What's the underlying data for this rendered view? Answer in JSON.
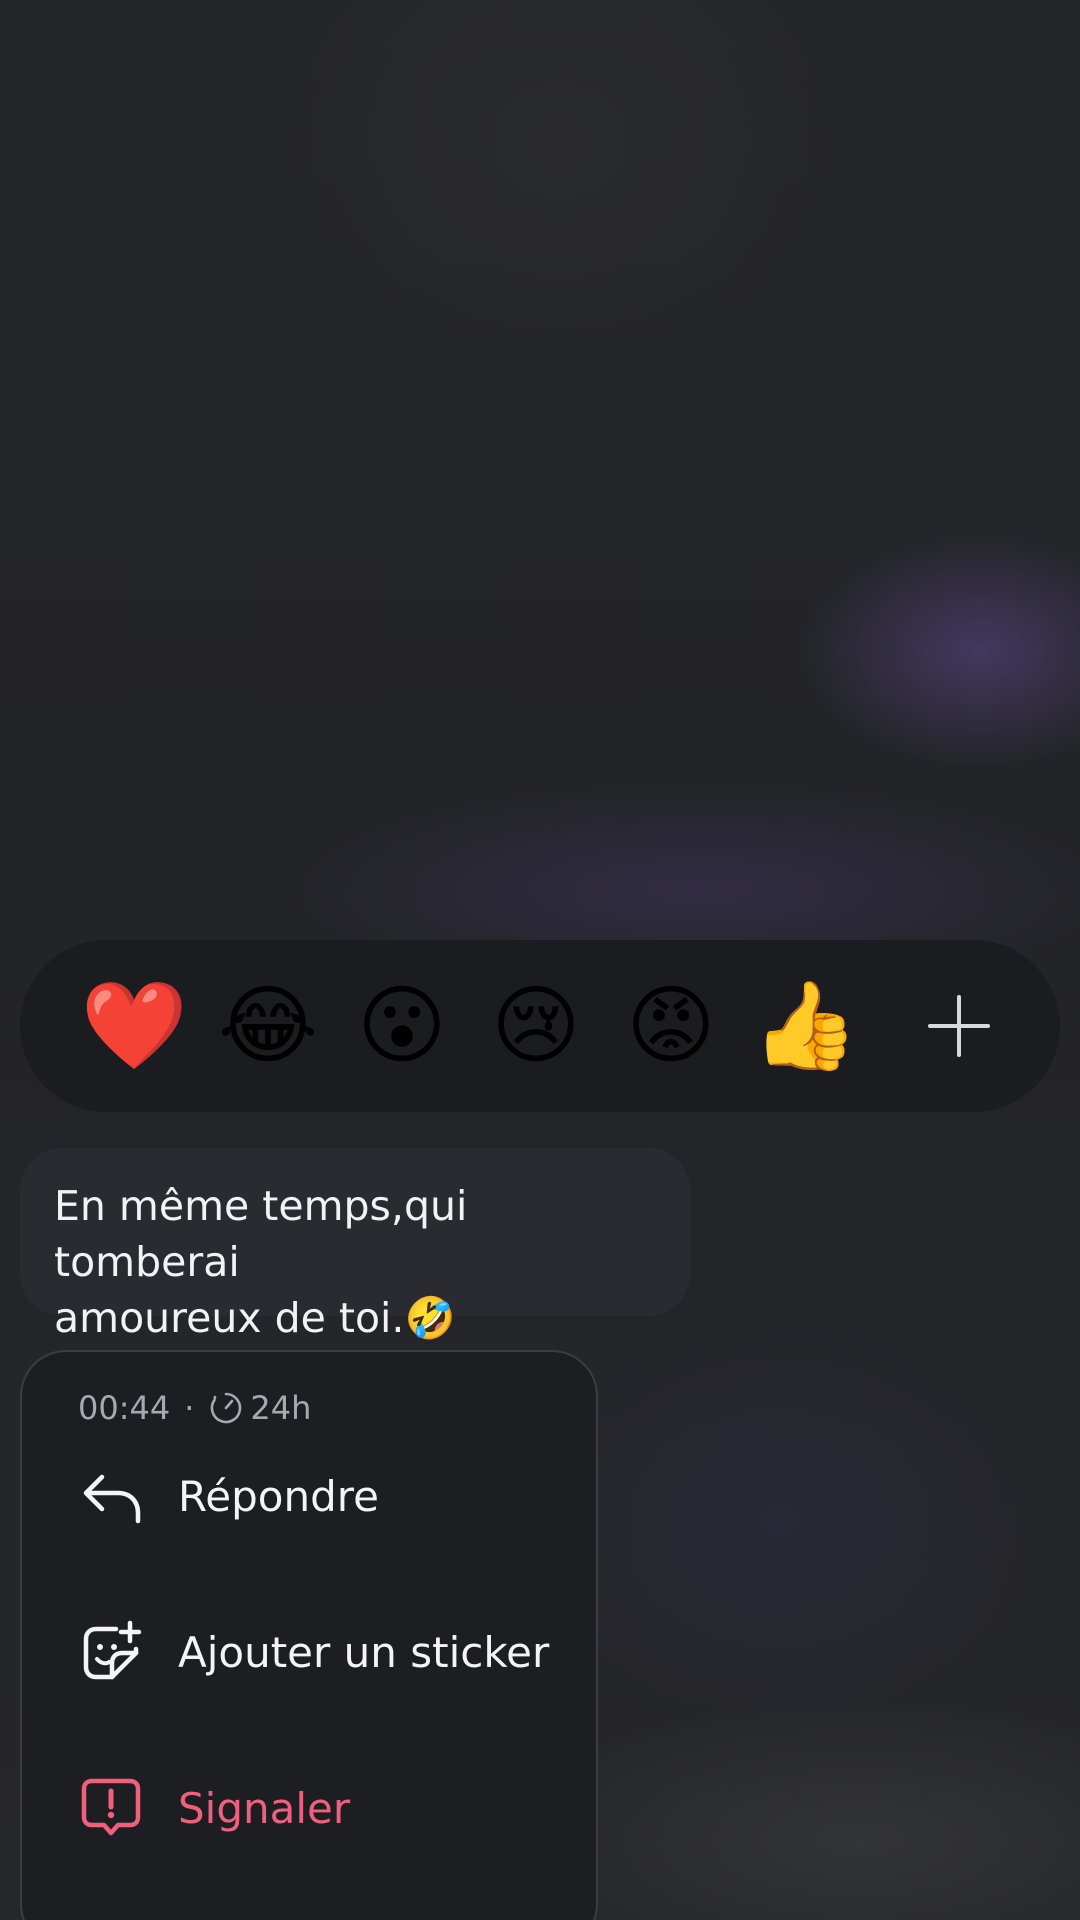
{
  "reactions": {
    "items": [
      {
        "emoji": "❤️",
        "name": "heart"
      },
      {
        "emoji": "😂",
        "name": "face-with-tears-of-joy"
      },
      {
        "emoji": "😮",
        "name": "face-with-open-mouth"
      },
      {
        "emoji": "😢",
        "name": "crying-face"
      },
      {
        "emoji": "😡",
        "name": "pouting-face"
      },
      {
        "emoji": "👍",
        "name": "thumbs-up"
      }
    ],
    "add_icon": "plus-icon"
  },
  "message": {
    "text": "En même temps,qui tomberai\namoureux de toi.🤣"
  },
  "menu": {
    "time": "00:44",
    "separator": "·",
    "duration": "24h",
    "timer_icon": "timer-icon",
    "items": [
      {
        "label": "Répondre",
        "icon": "reply-arrow-icon"
      },
      {
        "label": "Ajouter un sticker",
        "icon": "add-sticker-icon"
      },
      {
        "label": "Signaler",
        "icon": "report-icon",
        "color": "#f0607e"
      }
    ]
  },
  "colors": {
    "background": "#232427",
    "reaction_bar": "#1b1c1f",
    "bubble": "#2a2b31",
    "menu": "#1d1e21",
    "danger": "#f0607e"
  }
}
